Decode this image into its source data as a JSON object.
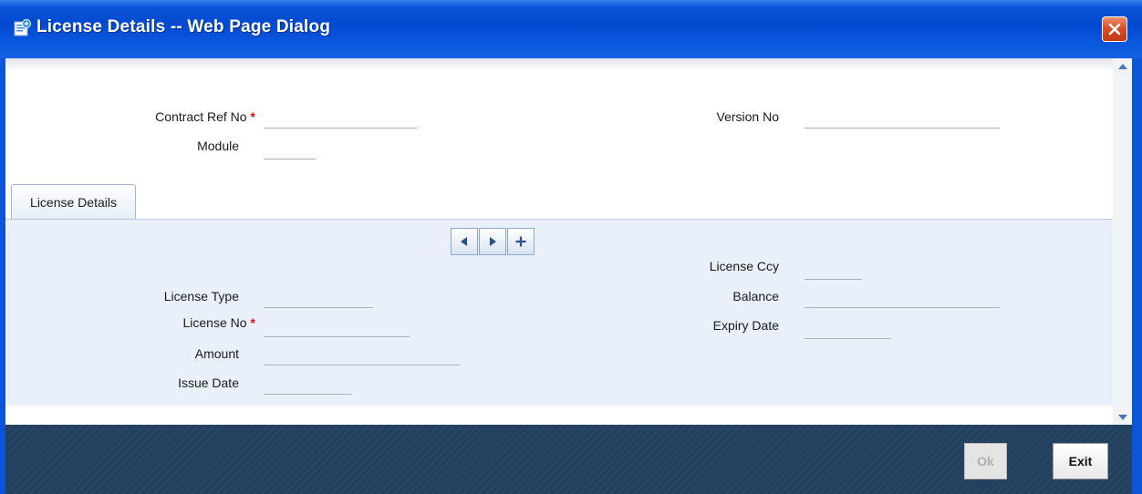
{
  "window": {
    "title": "License Details -- Web Page Dialog"
  },
  "header": {
    "contract_ref_label": "Contract Ref No",
    "contract_ref_value": "",
    "version_label": "Version No",
    "version_value": "",
    "module_label": "Module",
    "module_value": ""
  },
  "tabs": [
    {
      "label": "License Details",
      "active": true
    }
  ],
  "license": {
    "type_label": "License Type",
    "no_label": "License No",
    "amount_label": "Amount",
    "issue_date_label": "Issue Date",
    "ccy_label": "License Ccy",
    "balance_label": "Balance",
    "expiry_label": "Expiry Date"
  },
  "required_marker": "*",
  "nav_icons": [
    "previous-icon",
    "next-icon",
    "add-icon"
  ],
  "footer": {
    "ok_label": "Ok",
    "exit_label": "Exit",
    "ok_enabled": false
  },
  "colors": {
    "titlebar": "#0349d0",
    "footer": "#23405e",
    "panel": "#e9f0f9",
    "required": "#e01010",
    "close_button": "#c3390f"
  }
}
